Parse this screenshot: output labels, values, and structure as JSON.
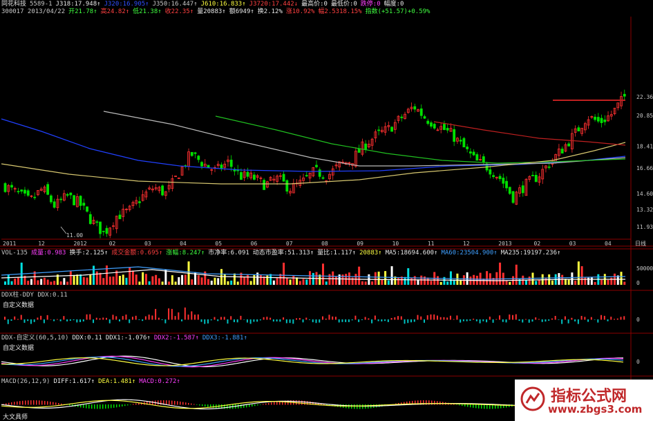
{
  "header": {
    "line1": [
      {
        "text": "同花科技",
        "color": "#e8e8e8"
      },
      {
        "text": "5589-1",
        "color": "#c8c8c8"
      },
      {
        "text": "J318:17.948↑",
        "color": "#e8e8e8"
      },
      {
        "text": "J320:16.905↑",
        "color": "#3050ff"
      },
      {
        "text": "J350:16.447↑",
        "color": "#c8c8c8"
      },
      {
        "text": "J610:16.833↑",
        "color": "#ffff40"
      },
      {
        "text": "J3720:17.442↓",
        "color": "#ff4040"
      },
      {
        "text": "最高价:0",
        "color": "#e8e8e8"
      },
      {
        "text": "最低价:0",
        "color": "#e8e8e8"
      },
      {
        "text": "跌停:0",
        "color": "#ff40ff"
      },
      {
        "text": "幅度:0",
        "color": "#e8e8e8"
      }
    ],
    "line2": [
      {
        "text": "300017 2013/04/22",
        "color": "#c8c8c8"
      },
      {
        "text": "开21.78↑",
        "color": "#40ff40"
      },
      {
        "text": "高24.82↑",
        "color": "#ff4040"
      },
      {
        "text": "低21.38↑",
        "color": "#40ff40"
      },
      {
        "text": "收22.35↑",
        "color": "#ff4040"
      },
      {
        "text": "量20883↑",
        "color": "#e8e8e8"
      },
      {
        "text": "额6949↑",
        "color": "#e8e8e8"
      },
      {
        "text": "换2.12%",
        "color": "#e8e8e8"
      },
      {
        "text": "涨10.92%",
        "color": "#ff4040"
      },
      {
        "text": "幅2.5318.15%",
        "color": "#ff4040"
      },
      {
        "text": "指数(+51.57)+0.59%",
        "color": "#40ff40"
      }
    ]
  },
  "price_axis": [
    "22.36",
    "20.85",
    "18.41",
    "16.66",
    "14.60",
    "13.32",
    "11.93"
  ],
  "min_label": "11.00",
  "date_axis": [
    "2011",
    "12",
    "2012",
    "02",
    "03",
    "04",
    "05",
    "06",
    "07",
    "08",
    "09",
    "10",
    "11",
    "12",
    "2013",
    "02",
    "03",
    "04"
  ],
  "date_axis_right": "日线",
  "vol_header": [
    {
      "text": "VOL-135",
      "color": "#c8c8c8"
    },
    {
      "text": "成量:0.983",
      "color": "#ff40ff"
    },
    {
      "text": "换手:2.125↑",
      "color": "#e8e8e8"
    },
    {
      "text": "成交金额:0.695↑",
      "color": "#ff4040"
    },
    {
      "text": "涨幅:8.247↑",
      "color": "#40ff40"
    },
    {
      "text": "市净率:6.091",
      "color": "#e8e8e8"
    },
    {
      "text": "动态市盈率:51.313↑",
      "color": "#e8e8e8"
    },
    {
      "text": "量比:1.117↑",
      "color": "#e8e8e8"
    },
    {
      "text": "20883↑",
      "color": "#ffff40"
    },
    {
      "text": "MA5:18694.600↑",
      "color": "#e8e8e8"
    },
    {
      "text": "MA60:23504.900↑",
      "color": "#40a0ff"
    },
    {
      "text": "MA235:19197.236↑",
      "color": "#e8e8e8"
    }
  ],
  "vol_axis": [
    "50000",
    "0"
  ],
  "ddx_header": "DDX柱-DDY DDX:0.11",
  "ddx_sub": "自定义数据",
  "ddx_axis": [
    "0"
  ],
  "ddx2_header": [
    {
      "text": "DDX-自定义(60,5,10)",
      "color": "#c8c8c8"
    },
    {
      "text": "DDX:0.11",
      "color": "#e8e8e8"
    },
    {
      "text": "DDX1:-1.076↑",
      "color": "#e8e8e8"
    },
    {
      "text": "DDX2:-1.587↑",
      "color": "#ff40ff"
    },
    {
      "text": "DDX3:-1.881↑",
      "color": "#40a0ff"
    }
  ],
  "ddx2_sub": "自定义数据",
  "ddx2_axis": [
    "0"
  ],
  "macd_header": [
    {
      "text": "MACD(26,12,9)",
      "color": "#c8c8c8"
    },
    {
      "text": "DIFF:1.617↑",
      "color": "#e8e8e8"
    },
    {
      "text": "DEA:1.481↑",
      "color": "#ffff40"
    },
    {
      "text": "MACD:0.272↑",
      "color": "#ff40ff"
    }
  ],
  "macd_sub": "大文具师",
  "watermark": {
    "title": "指标公式网",
    "url": "www.zbgs3.com"
  },
  "chart_data": {
    "type": "line",
    "title": "",
    "xlabel": "",
    "ylabel": "",
    "ylim": [
      11.0,
      22.36
    ],
    "series": [
      {
        "name": "close",
        "values": [
          15.2,
          14.6,
          14.0,
          15.0,
          13.6,
          14.4,
          13.8,
          12.4,
          11.4,
          12.8,
          13.2,
          14.3,
          15.1,
          14.6,
          16.2,
          17.8,
          17.0,
          16.4,
          17.1,
          16.0,
          15.9,
          15.3,
          15.8,
          15.0,
          15.5,
          16.4,
          16.0,
          16.9,
          17.3,
          18.5,
          19.3,
          19.8,
          20.7,
          21.6,
          20.6,
          20.0,
          19.4,
          18.3,
          17.2,
          16.7,
          15.8,
          14.3,
          15.3,
          16.0,
          17.1,
          18.2,
          19.4,
          20.8,
          20.3,
          21.0,
          22.36
        ]
      }
    ]
  }
}
